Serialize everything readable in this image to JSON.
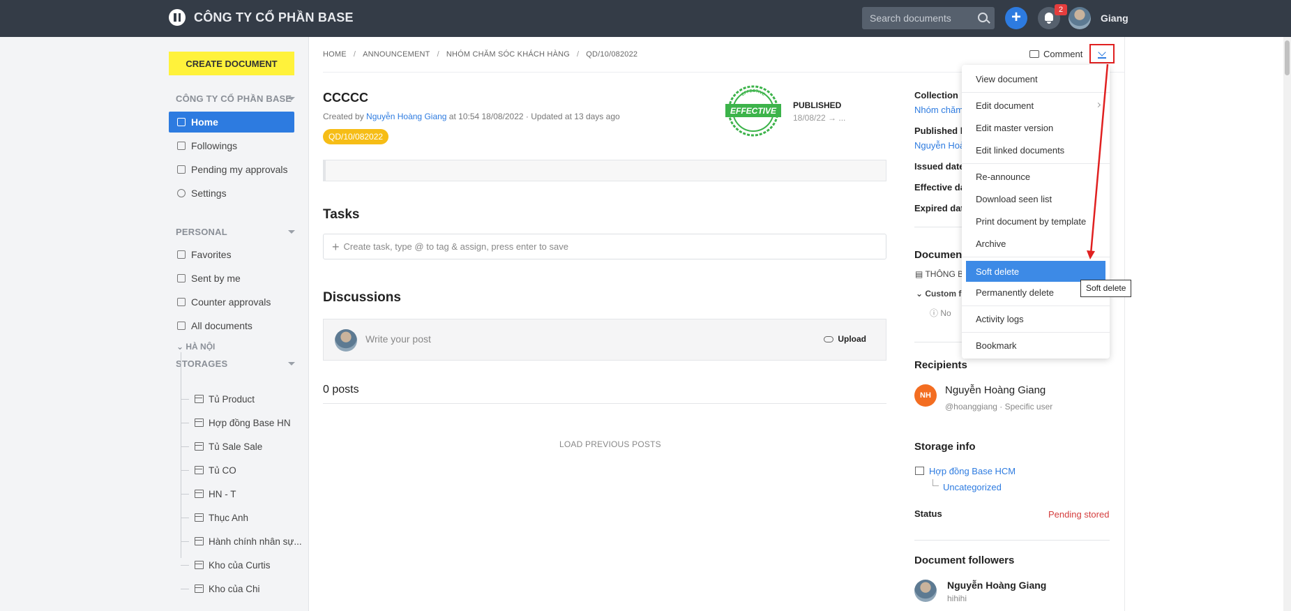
{
  "brand": {
    "name": "CÔNG TY CỔ PHẦN BASE"
  },
  "header": {
    "search_placeholder": "Search documents",
    "notification_count": "2",
    "user_name": "Giang"
  },
  "sidebar": {
    "create_button": "CREATE DOCUMENT",
    "company_section": "CÔNG TY CỔ PHẦN BASE",
    "main_items": [
      {
        "label": "Home",
        "icon": "home-icon",
        "active": true
      },
      {
        "label": "Followings",
        "icon": "followings-icon"
      },
      {
        "label": "Pending my approvals",
        "icon": "approvals-icon"
      },
      {
        "label": "Settings",
        "icon": "settings-icon"
      }
    ],
    "personal_section": "PERSONAL",
    "personal_items": [
      {
        "label": "Favorites",
        "icon": "favorites-icon"
      },
      {
        "label": "Sent by me",
        "icon": "sent-icon"
      },
      {
        "label": "Counter approvals",
        "icon": "counter-icon"
      },
      {
        "label": "All documents",
        "icon": "all-docs-icon"
      }
    ],
    "storages_section": "STORAGES",
    "storage_group": "HÀ NỘI",
    "storage_items": [
      "Tủ Product",
      "Hợp đồng Base HN",
      "Tủ Sale Sale",
      "Tủ CO",
      "HN - T",
      "Thục Anh",
      "Hành chính nhân sự...",
      "Kho của Curtis",
      "Kho của Chi"
    ]
  },
  "breadcrumb": [
    "HOME",
    "ANNOUNCEMENT",
    "NHÓM CHĂM SÓC KHÁCH HÀNG",
    "QD/10/082022"
  ],
  "actions": {
    "comment": "Comment"
  },
  "document": {
    "title": "CCCCC",
    "meta_prefix": "Created by ",
    "author": "Nguyễn Hoàng Giang",
    "meta_suffix": " at 10:54 18/08/2022 · Updated at 13 days ago",
    "code": "QD/10/082022",
    "stamp_text": "EFFECTIVE",
    "stamp_ring": "EFFECTIVE",
    "status": "PUBLISHED",
    "status_date": "18/08/22 → ..."
  },
  "tasks": {
    "heading": "Tasks",
    "placeholder": "Create task, type @ to tag & assign, press enter to save"
  },
  "discussions": {
    "heading": "Discussions",
    "post_placeholder": "Write your post",
    "upload_label": "Upload",
    "posts_count": "0 posts",
    "load_previous": "LOAD PREVIOUS POSTS"
  },
  "info": {
    "collection_label": "Collection",
    "collection_value": "Nhóm chăm",
    "published_by_label": "Published b",
    "published_by_value": "Nguyễn Hoà",
    "issued_label": "Issued date",
    "effective_label": "Effective da",
    "expired_label": "Expired date",
    "document_label": "Document",
    "doc_item": "THÔNG B",
    "custom_label": "Custom f",
    "no_label": "No"
  },
  "recipients": {
    "heading": "Recipients",
    "initials": "NH",
    "name": "Nguyễn Hoàng Giang",
    "sub": "@hoanggiang · Specific user"
  },
  "storage_info": {
    "heading": "Storage info",
    "storage": "Hợp đồng Base HCM",
    "category": "Uncategorized",
    "status_label": "Status",
    "status_value": "Pending stored"
  },
  "followers": {
    "heading": "Document followers",
    "name": "Nguyễn Hoàng Giang",
    "sub": "hihihi"
  },
  "dropdown": {
    "items": [
      {
        "label": "View document"
      },
      {
        "label": "Edit document",
        "submenu": true
      },
      {
        "label": "Edit master version"
      },
      {
        "label": "Edit linked documents"
      },
      {
        "label": "Re-announce"
      },
      {
        "label": "Download seen list"
      },
      {
        "label": "Print document by template"
      },
      {
        "label": "Archive"
      },
      {
        "label": "Soft delete",
        "active": true
      },
      {
        "label": "Permanently delete"
      },
      {
        "label": "Activity logs"
      },
      {
        "label": "Bookmark"
      }
    ],
    "tooltip": "Soft delete"
  },
  "colors": {
    "topbar": "#343c47",
    "accent": "#2d7be0",
    "create_button": "#fff23b",
    "annotation": "#e02020",
    "status_pending": "#d43d3d",
    "stamp": "#3cb34a"
  }
}
